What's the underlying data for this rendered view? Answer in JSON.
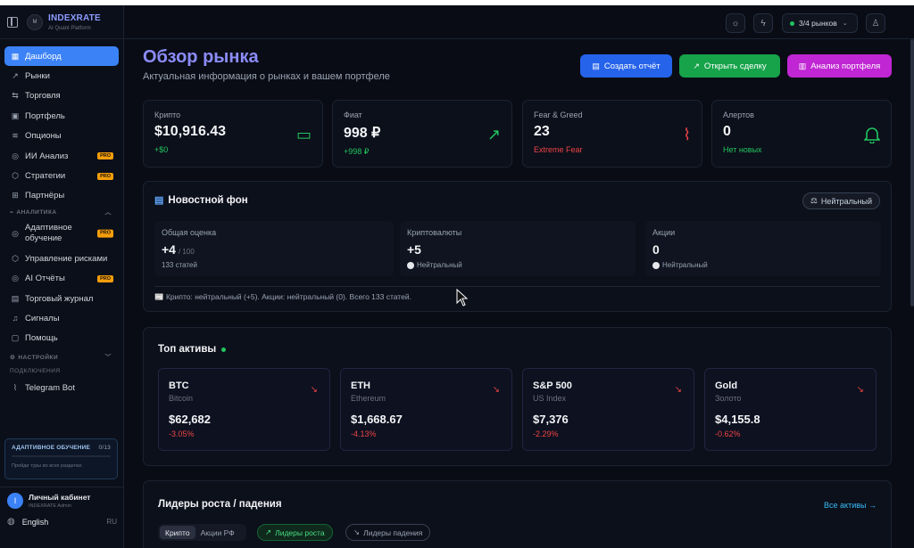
{
  "brand": {
    "name": "INDEXRATE",
    "subtitle": "AI Quant Platform",
    "logo_text": "M"
  },
  "sidebar": {
    "items": [
      {
        "label": "Дашборд",
        "icon": "grid-icon",
        "glyph": "▦",
        "active": true
      },
      {
        "label": "Рынки",
        "icon": "trend-icon",
        "glyph": "↗"
      },
      {
        "label": "Торговля",
        "icon": "swap-icon",
        "glyph": "⇆"
      },
      {
        "label": "Портфель",
        "icon": "briefcase-icon",
        "glyph": "▣"
      },
      {
        "label": "Опционы",
        "icon": "layers-icon",
        "glyph": "≋"
      },
      {
        "label": "ИИ Анализ",
        "icon": "brain-icon",
        "glyph": "◎",
        "pro": "PRO"
      },
      {
        "label": "Стратегии",
        "icon": "shield-icon",
        "glyph": "⬡",
        "pro": "PRO"
      },
      {
        "label": "Партнёры",
        "icon": "gift-icon",
        "glyph": "⊞"
      }
    ],
    "analytics_section": "АНАЛИТИКА",
    "analytics_items": [
      {
        "label": "Адаптивное обучение",
        "icon": "brain-icon",
        "glyph": "◎",
        "pro": "PRO"
      },
      {
        "label": "Управление рисками",
        "icon": "shield-icon",
        "glyph": "⬡"
      },
      {
        "label": "AI Отчёты",
        "icon": "brain-icon",
        "glyph": "◎",
        "pro": "PRO"
      },
      {
        "label": "Торговый журнал",
        "icon": "book-icon",
        "glyph": "▤"
      },
      {
        "label": "Сигналы",
        "icon": "bell-icon",
        "glyph": "♫"
      },
      {
        "label": "Помощь",
        "icon": "help-icon",
        "glyph": "▢"
      }
    ],
    "settings_section": "НАСТРОЙКИ",
    "connections_label": "ПОДКЛЮЧЕНИЯ",
    "telegram": "Telegram Bot",
    "adaptive": {
      "title": "АДАПТИВНОЕ ОБУЧЕНИЕ",
      "count": "0/13",
      "progress": 0,
      "hint": "Пройди туры во всех разделах"
    },
    "account": {
      "initial": "I",
      "name": "Личный кабинет",
      "sub": "INDEXRATE Admin"
    },
    "language": {
      "label": "English",
      "code": "RU"
    }
  },
  "topbar": {
    "markets": "3/4 рынков"
  },
  "header": {
    "title": "Обзор рынка",
    "subtitle": "Актуальная информация о рынках и вашем портфеле"
  },
  "actions": {
    "report": "Создать отчёт",
    "trade": "Открыть сделку",
    "analysis": "Анализ портфеля"
  },
  "stats": [
    {
      "label": "Крипто",
      "value": "$10,916.43",
      "sub": "+$0",
      "sub_color": "#22c55e",
      "icon": "wallet-icon",
      "glyph": "▭",
      "icon_color": "#22c55e"
    },
    {
      "label": "Фиат",
      "value": "998 ₽",
      "sub": "+998 ₽",
      "sub_color": "#22c55e",
      "icon": "trend-up-icon",
      "glyph": "↗",
      "icon_color": "#22c55e"
    },
    {
      "label": "Fear & Greed",
      "value": "23",
      "sub": "Extreme Fear",
      "sub_color": "#ef4444",
      "icon": "pulse-icon",
      "glyph": "⌇",
      "icon_color": "#ef4444"
    },
    {
      "label": "Алертов",
      "value": "0",
      "sub": "Нет новых",
      "sub_color": "#22c55e",
      "icon": "bell-icon",
      "glyph": "🔔",
      "icon_color": "#22c55e"
    }
  ],
  "news": {
    "title": "Новостной фон",
    "badge": "Нейтральный",
    "cells": [
      {
        "label": "Общая оценка",
        "value": "+4",
        "suffix": "/ 100",
        "sub": "133 статей"
      },
      {
        "label": "Криптовалюты",
        "value": "+5",
        "suffix": "",
        "sub": "Нейтральный"
      },
      {
        "label": "Акции",
        "value": "0",
        "suffix": "",
        "sub": "Нейтральный"
      }
    ],
    "footer": "📰 Крипто: нейтральный (+5). Акции: нейтральный (0). Всего 133 статей."
  },
  "top_assets": {
    "title": "Топ активы",
    "items": [
      {
        "symbol": "BTC",
        "name": "Bitcoin",
        "price": "$62,682",
        "change": "-3.05%"
      },
      {
        "symbol": "ETH",
        "name": "Ethereum",
        "price": "$1,668.67",
        "change": "-4.13%"
      },
      {
        "symbol": "S&P 500",
        "name": "US Index",
        "price": "$7,376",
        "change": "-2.29%"
      },
      {
        "symbol": "Gold",
        "name": "Золото",
        "price": "$4,155.8",
        "change": "-0.62%"
      }
    ]
  },
  "leaders": {
    "title": "Лидеры роста / падения",
    "all_link": "Все активы →",
    "tabs": [
      "Крипто",
      "Акции РФ"
    ],
    "growth": "Лидеры роста",
    "fall": "Лидеры падения"
  }
}
